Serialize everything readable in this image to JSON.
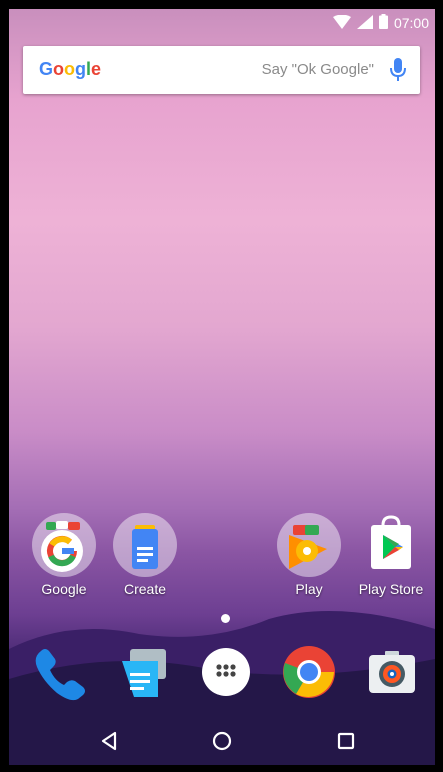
{
  "status_bar": {
    "time": "07:00"
  },
  "search_bar": {
    "logo_text": "Google",
    "hint": "Say \"Ok Google\""
  },
  "home_apps": [
    {
      "label": "Google"
    },
    {
      "label": "Create"
    },
    {
      "label": "Play"
    },
    {
      "label": "Play Store"
    }
  ],
  "dock_apps": [
    {
      "icon": "phone-icon"
    },
    {
      "icon": "messenger-icon"
    },
    {
      "icon": "app-drawer-icon"
    },
    {
      "icon": "chrome-icon"
    },
    {
      "icon": "camera-icon"
    }
  ],
  "navigation": {
    "back": "back-icon",
    "home": "home-icon",
    "recents": "recents-icon"
  },
  "colors": {
    "google_blue": "#4285F4",
    "google_red": "#EA4335",
    "google_yellow": "#FBBC05",
    "google_green": "#34A853"
  }
}
